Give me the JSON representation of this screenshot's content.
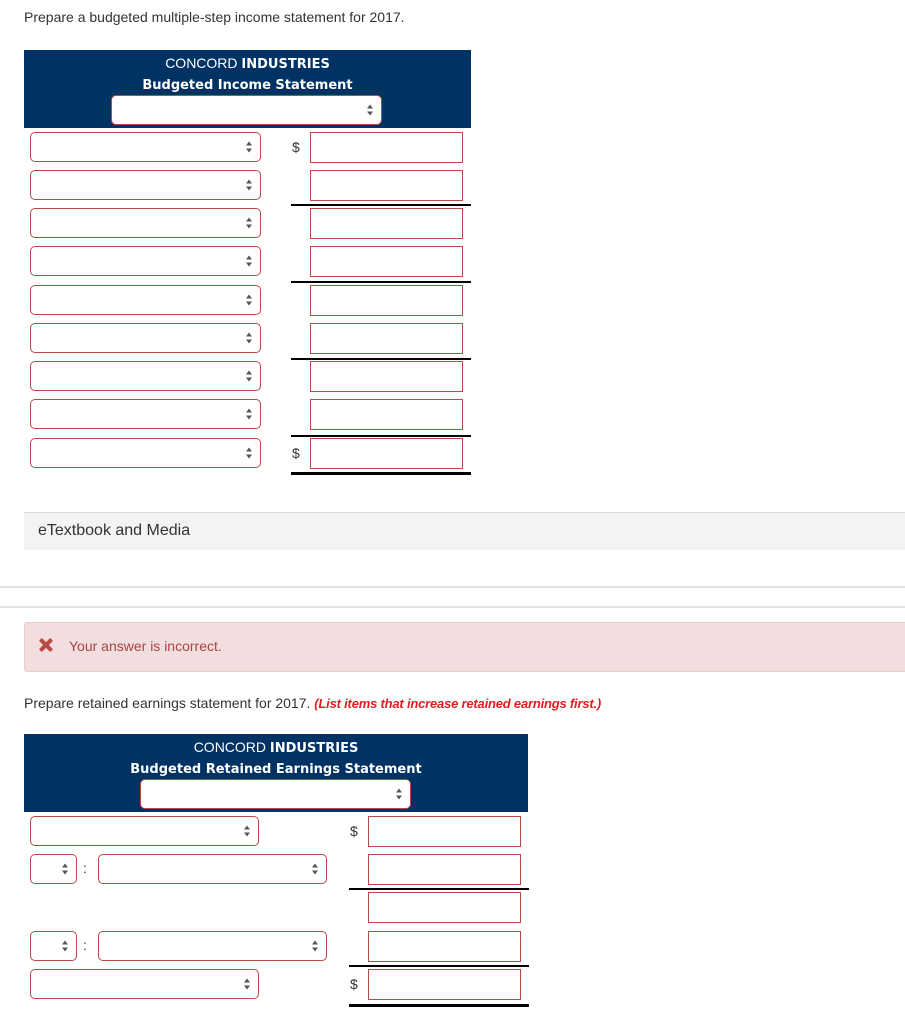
{
  "part1": {
    "prompt": "Prepare a budgeted multiple-step income statement for 2017.",
    "company_regular": "CONCORD ",
    "company_bold": "INDUSTRIES",
    "statement_title": "Budgeted Income Statement",
    "period_select": {
      "value": ""
    },
    "rows": [
      {
        "account": "",
        "amount": "",
        "dollar": "$"
      },
      {
        "account": "",
        "amount": "",
        "dollar": ""
      },
      {
        "account": "",
        "amount": "",
        "dollar": ""
      },
      {
        "account": "",
        "amount": "",
        "dollar": ""
      },
      {
        "account": "",
        "amount": "",
        "dollar": ""
      },
      {
        "account": "",
        "amount": "",
        "dollar": ""
      },
      {
        "account": "",
        "amount": "",
        "dollar": ""
      },
      {
        "account": "",
        "amount": "",
        "dollar": ""
      },
      {
        "account": "",
        "amount": "",
        "dollar": "$"
      }
    ]
  },
  "etextbook": {
    "label": "eTextbook and Media"
  },
  "feedback": {
    "icon": "x-icon",
    "message": "Your answer is incorrect.",
    "color": "#a94442",
    "bg": "#f2dede"
  },
  "part2": {
    "prompt": "Prepare retained earnings statement for 2017. ",
    "note": "(List items that increase retained earnings first.)",
    "company_regular": "CONCORD ",
    "company_bold": "INDUSTRIES",
    "statement_title": "Budgeted Retained Earnings Statement",
    "period_select": {
      "value": ""
    },
    "rows": [
      {
        "account": "",
        "amount": "",
        "dollar": "$"
      },
      {
        "prefix": "",
        "account": "",
        "amount": "",
        "dollar": "",
        "colon": ":"
      },
      {
        "amount": "",
        "dollar": ""
      },
      {
        "prefix": "",
        "account": "",
        "amount": "",
        "dollar": "",
        "colon": ":"
      },
      {
        "account": "",
        "amount": "",
        "dollar": "$"
      }
    ]
  },
  "colors": {
    "header_bg": "#003264",
    "error_border": "#b94a48",
    "note_red": "#e0201f"
  }
}
